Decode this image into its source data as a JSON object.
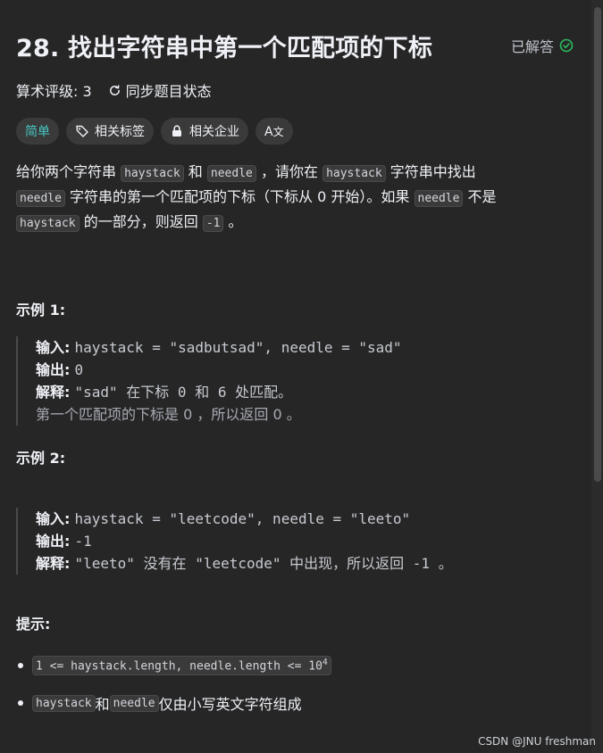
{
  "problem": {
    "title": "28. 找出字符串中第一个匹配项的下标",
    "status": "已解答",
    "rating": "算术评级: 3",
    "sync_label": "同步题目状态"
  },
  "tags": {
    "difficulty": "简单",
    "related_tags": "相关标签",
    "related_companies": "相关企业",
    "font_toggle": "A"
  },
  "description": {
    "t1": "给你两个字符串 ",
    "c1": "haystack",
    "t2": " 和 ",
    "c2": "needle",
    "t3": " ，请你在 ",
    "c3": "haystack",
    "t4": " 字符串中找出 ",
    "c4": "needle",
    "t5": " 字符串的第一个匹配项的下标（下标从 0 开始）。如果 ",
    "c5": "needle",
    "t6": " 不是 ",
    "c6": "haystack",
    "t7": " 的一部分，则返回  ",
    "c7": "-1",
    "t8": " 。"
  },
  "example1": {
    "title": "示例 1:",
    "input_label": "输入:",
    "input": "haystack = \"sadbutsad\", needle = \"sad\"",
    "output_label": "输出:",
    "output": "0",
    "explain_label": "解释:",
    "explain": "\"sad\" 在下标 0 和 6 处匹配。",
    "explain2": "第一个匹配项的下标是 0 ，所以返回 0 。"
  },
  "example2": {
    "title": "示例 2:",
    "input_label": "输入:",
    "input": "haystack = \"leetcode\", needle = \"leeto\"",
    "output_label": "输出:",
    "output": "-1",
    "explain_label": "解释:",
    "explain": "\"leeto\" 没有在 \"leetcode\" 中出现，所以返回 -1 。"
  },
  "hints": {
    "title": "提示:",
    "h1_code": "1 <= haystack.length, needle.length <= 10",
    "h1_sup": "4",
    "h2_c1": "haystack",
    "h2_t1": " 和 ",
    "h2_c2": "needle",
    "h2_t2": " 仅由小写英文字符组成"
  },
  "watermark": "CSDN @JNU freshman",
  "colors": {
    "background": "#262626",
    "easy": "#46c6c2",
    "solved_check": "#2cbb5d"
  }
}
